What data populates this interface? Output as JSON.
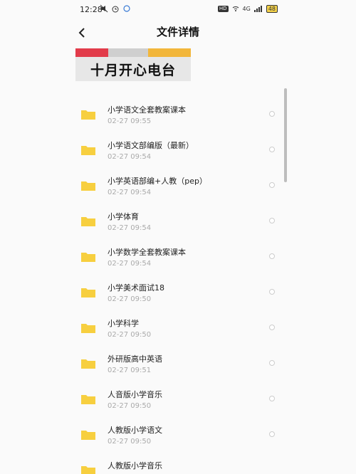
{
  "status_bar": {
    "time": "12:28",
    "left_icons": [
      "muted-icon",
      "alarm-icon",
      "sync-icon"
    ],
    "badge_hd": "HD",
    "network": "4G",
    "battery": "48"
  },
  "header": {
    "title": "文件详情"
  },
  "banner": {
    "text": "十月开心电台"
  },
  "files": [
    {
      "name": "小学语文全套教案课本",
      "time": "02-27  09:55"
    },
    {
      "name": "小学语文部编版（最新）",
      "time": "02-27  09:54"
    },
    {
      "name": "小学英语部编+人教（pep）",
      "time": "02-27  09:54"
    },
    {
      "name": "小学体育",
      "time": "02-27  09:54"
    },
    {
      "name": "小学数学全套教案课本",
      "time": "02-27  09:54"
    },
    {
      "name": "小学美术面试18",
      "time": "02-27  09:50"
    },
    {
      "name": "小学科学",
      "time": "02-27  09:50"
    },
    {
      "name": "外研版高中英语",
      "time": "02-27  09:51"
    },
    {
      "name": "人音版小学音乐",
      "time": "02-27  09:50"
    },
    {
      "name": "人教版小学语文",
      "time": "02-27  09:50"
    },
    {
      "name": "人教版小学音乐",
      "time": ""
    }
  ],
  "colors": {
    "folder": "#f7cf3f",
    "accent_red": "#e23b4a",
    "accent_yellow": "#f2b63a"
  }
}
